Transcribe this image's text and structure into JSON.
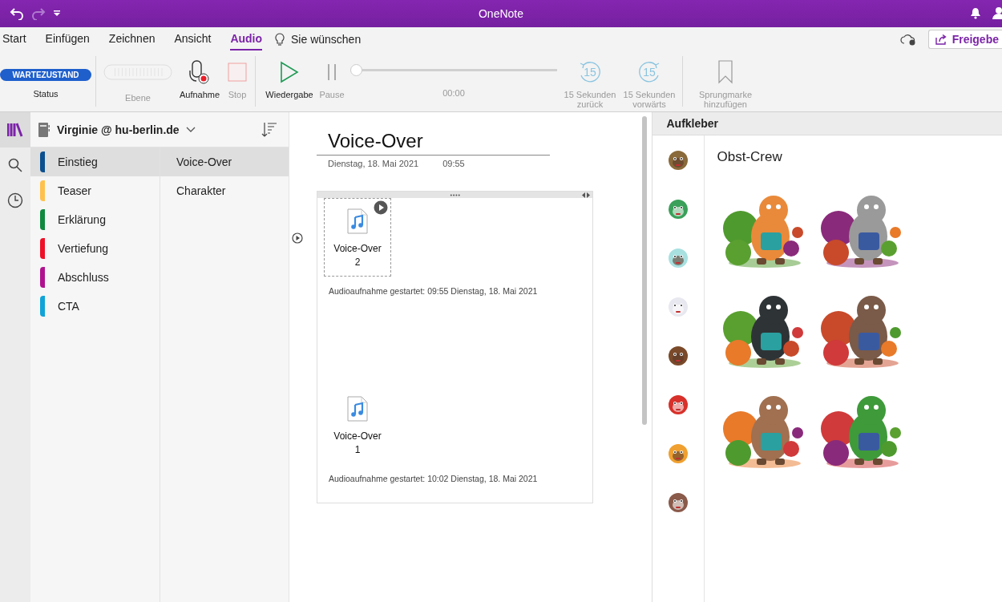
{
  "window": {
    "title": "OneNote"
  },
  "tabs": [
    {
      "label": "Start",
      "selected": false
    },
    {
      "label": "Einfügen",
      "selected": false
    },
    {
      "label": "Zeichnen",
      "selected": false
    },
    {
      "label": "Ansicht",
      "selected": false
    },
    {
      "label": "Audio",
      "selected": true
    }
  ],
  "tell_me": "Sie wünschen",
  "share_button": "Freigebe",
  "ribbon": [
    {
      "items": [
        {
          "kind": "status",
          "badge": "WARTEZUSTAND",
          "label": "Status",
          "disabled": false
        }
      ]
    },
    {
      "items": [
        {
          "kind": "level",
          "label": "Ebene",
          "disabled": true
        },
        {
          "kind": "record",
          "label": "Aufnahme",
          "disabled": false
        },
        {
          "kind": "stop",
          "label": "Stop",
          "disabled": true
        }
      ]
    },
    {
      "items": [
        {
          "kind": "play",
          "label": "Wiedergabe",
          "disabled": false
        },
        {
          "kind": "pause",
          "label": "Pause",
          "disabled": true
        },
        {
          "kind": "seek",
          "level": 0,
          "time": "00:00"
        },
        {
          "kind": "back",
          "icon_text": "15",
          "label": "15 Sekunden zurück",
          "disabled": true
        },
        {
          "kind": "forward",
          "icon_text": "15",
          "label": "15 Sekunden vorwärts",
          "disabled": true
        }
      ]
    },
    {
      "items": [
        {
          "kind": "bookmark",
          "label": "Sprungmarke hinzufügen",
          "disabled": true
        }
      ]
    }
  ],
  "nav": [
    {
      "kind": "notebooks",
      "selected": true
    },
    {
      "kind": "search",
      "selected": false
    },
    {
      "kind": "recent",
      "selected": false
    }
  ],
  "notebook": {
    "name": "Virginie @ hu-berlin.de"
  },
  "sections": [
    {
      "label": "Einstieg",
      "color": "#0b4f8f",
      "selected": true
    },
    {
      "label": "Teaser",
      "color": "#ffc14d",
      "selected": false
    },
    {
      "label": "Erklärung",
      "color": "#0f8a3e",
      "selected": false
    },
    {
      "label": "Vertiefung",
      "color": "#ee1127",
      "selected": false
    },
    {
      "label": "Abschluss",
      "color": "#b0128f",
      "selected": false
    },
    {
      "label": "CTA",
      "color": "#0fa3d8",
      "selected": false
    }
  ],
  "pages": [
    {
      "label": "Voice-Over",
      "selected": true
    },
    {
      "label": "Charakter",
      "selected": false
    }
  ],
  "note": {
    "title": "Voice-Over",
    "date": "Dienstag, 18. Mai 2021",
    "time": "09:55",
    "audio": [
      {
        "name": [
          "Voice-Over",
          "2"
        ],
        "selected": true,
        "caption": "Audioaufnahme gestartet: 09:55 Dienstag, 18. Mai 2021"
      },
      {
        "name": [
          "Voice-Over",
          "1"
        ],
        "selected": false,
        "caption": "Audioaufnahme gestartet: 10:02 Dienstag, 18. Mai 2021"
      }
    ]
  },
  "stickers": {
    "title": "Aufkleber",
    "pack_title": "Obst-Crew"
  }
}
